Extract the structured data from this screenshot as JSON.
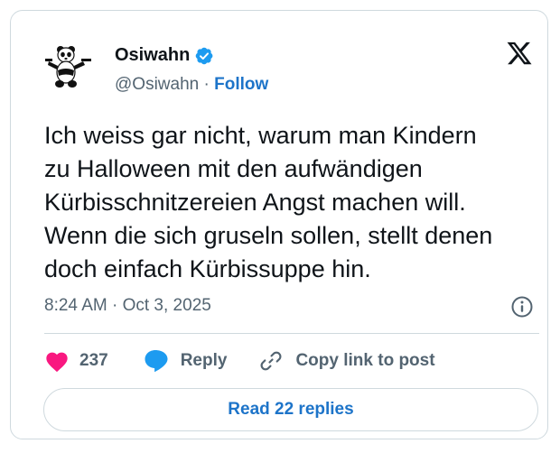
{
  "author": {
    "name": "Osiwahn",
    "handle": "@Osiwahn",
    "separator": "·",
    "follow_label": "Follow",
    "verified": true
  },
  "tweet": {
    "lines": [
      "Ich weiss gar nicht, warum man Kindern",
      "zu Halloween mit den aufwändigen",
      "Kürbisschnitzereien Angst machen will.",
      "Wenn die sich gruseln sollen, stellt denen",
      "doch einfach Kürbissuppe hin."
    ],
    "timestamp": "8:24 AM · Oct 3, 2025"
  },
  "actions": {
    "like_count": "237",
    "reply_label": "Reply",
    "copy_link_label": "Copy link to post"
  },
  "footer": {
    "read_replies_label": "Read 22 replies"
  },
  "colors": {
    "like": "#f91880",
    "reply": "#1d9bf0",
    "verified": "#1d9bf0",
    "link": "#1d74c9",
    "secondary_text": "#536471",
    "border": "#cfd9de"
  },
  "icons": {
    "avatar": "panda-avatar",
    "verified": "verified-badge-icon",
    "brand": "x-logo-icon",
    "info": "info-icon",
    "like": "heart-icon",
    "reply": "speech-bubble-icon",
    "copy": "link-icon"
  }
}
